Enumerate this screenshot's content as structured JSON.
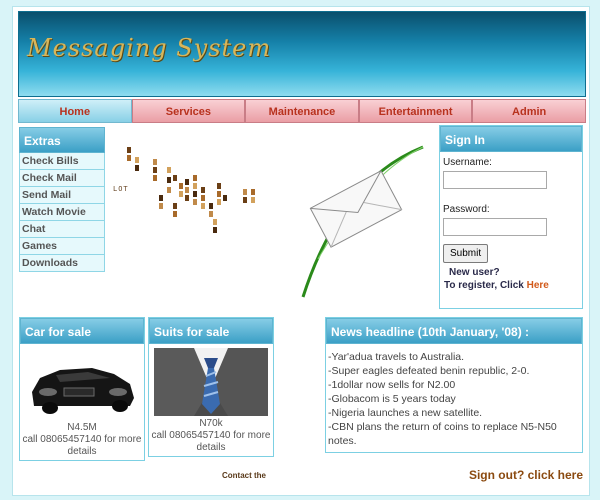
{
  "banner": {
    "title": "Messaging System"
  },
  "nav": {
    "items": [
      "Home",
      "Services",
      "Maintenance",
      "Entertainment",
      "Admin"
    ]
  },
  "extras": {
    "title": "Extras",
    "items": [
      "Check Bills",
      "Check Mail",
      "Send Mail",
      "Watch Movie",
      "Chat",
      "Games",
      "Downloads"
    ]
  },
  "decor": {
    "lot_text": "LOT"
  },
  "signin": {
    "title": "Sign In",
    "username_label": "Username:",
    "password_label": "Password:",
    "submit_label": "Submit",
    "new_user": "New user?",
    "register_prefix": "To register, Click ",
    "register_link": "Here"
  },
  "car": {
    "title": "Car for sale",
    "price": "N4.5M",
    "contact": "call 08065457140 for more details"
  },
  "suits": {
    "title": "Suits for sale",
    "price": "N70k",
    "contact": "call 08065457140 for more details"
  },
  "news": {
    "title": "News headline (10th January, '08) :",
    "items": [
      "-Yar'adua travels to Australia.",
      "-Super eagles defeated benin republic, 2-0.",
      "-1dollar now sells for N2.00",
      "-Globacom is 5 years today",
      "-Nigeria launches a new satellite.",
      "-CBN plans the return of coins to replace N5-N50 notes."
    ]
  },
  "footer": {
    "contact": "Contact the",
    "signout_prefix": "Sign out? click ",
    "signout_link": "here"
  },
  "colors": {
    "banner": "#1580a8",
    "nav_active": "#88d0e6",
    "nav": "#ea9ea5",
    "nav_text": "#b8321e",
    "accent_link": "#d25a1a"
  }
}
